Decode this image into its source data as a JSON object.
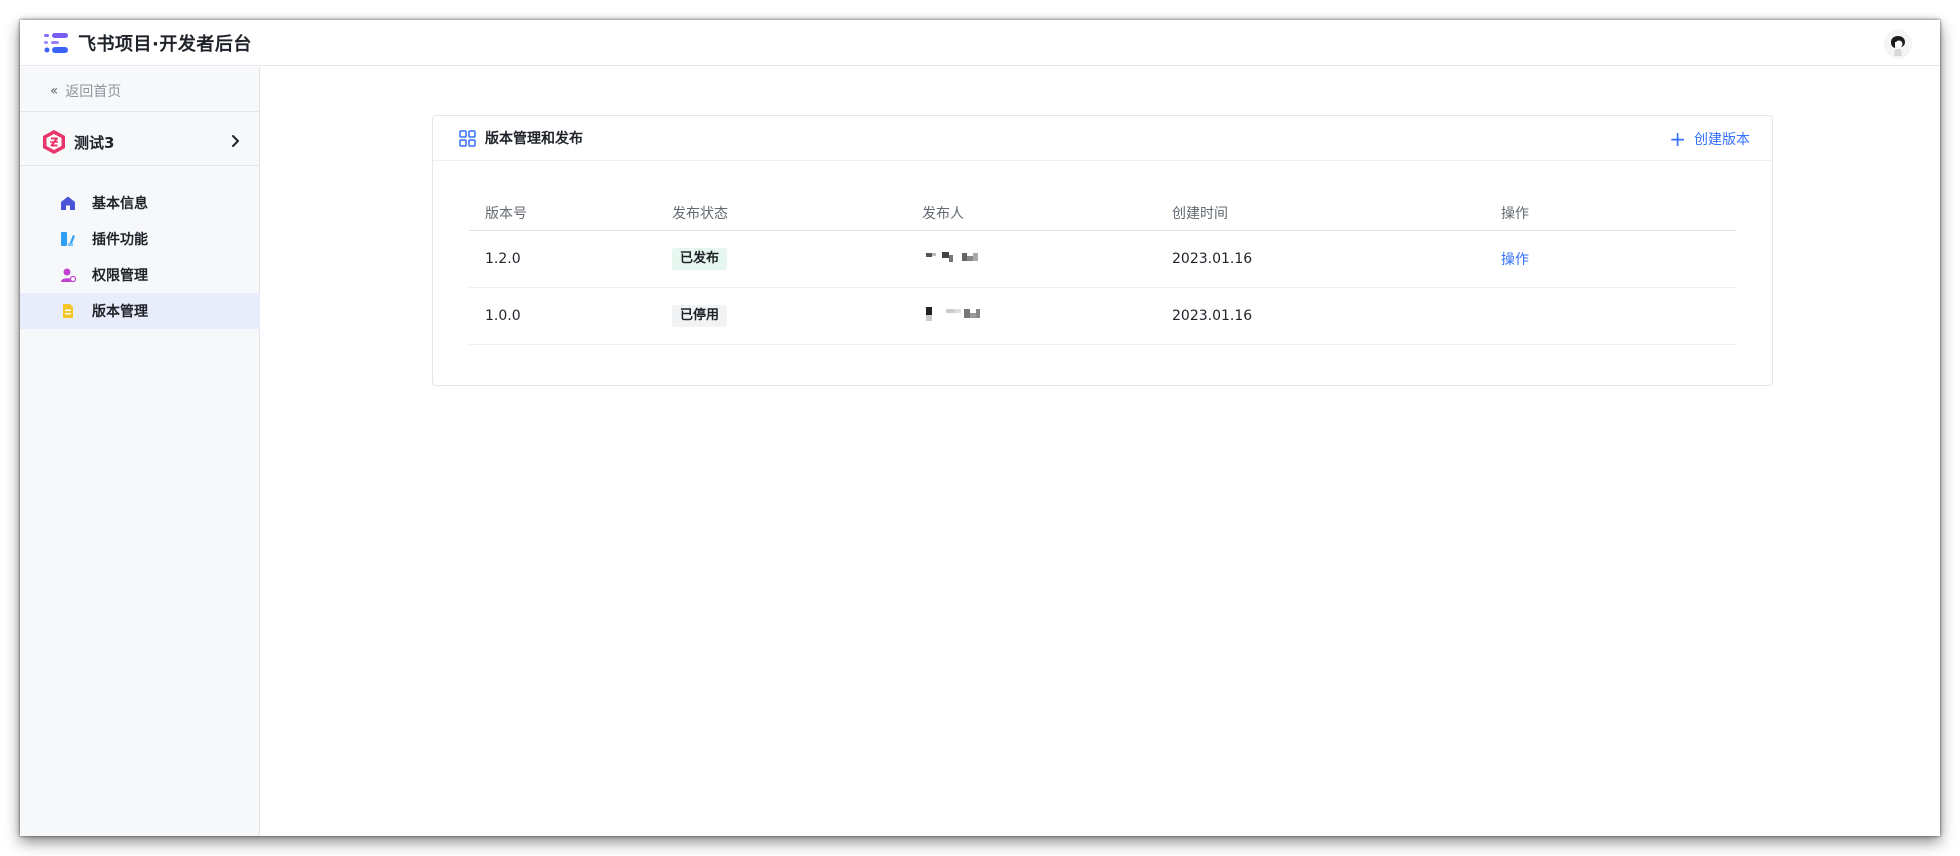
{
  "header": {
    "app_title": "飞书项目·开发者后台",
    "brand_color": "#7b5cf5"
  },
  "sidebar": {
    "back_label": "返回首页",
    "project": {
      "name": "测试3",
      "icon": "project-hexagon-icon"
    },
    "items": [
      {
        "label": "基本信息",
        "icon": "home-icon",
        "active": false
      },
      {
        "label": "插件功能",
        "icon": "plugin-icon",
        "active": false
      },
      {
        "label": "权限管理",
        "icon": "permission-user-icon",
        "active": false
      },
      {
        "label": "版本管理",
        "icon": "document-icon",
        "active": true
      }
    ]
  },
  "main": {
    "card_title": "版本管理和发布",
    "create_label": "创建版本",
    "table": {
      "columns": [
        "版本号",
        "发布状态",
        "发布人",
        "创建时间",
        "操作"
      ],
      "rows": [
        {
          "version": "1.2.0",
          "status": "已发布",
          "status_type": "published",
          "publisher": "",
          "created": "2023.01.16",
          "action": "操作"
        },
        {
          "version": "1.0.0",
          "status": "已停用",
          "status_type": "stopped",
          "publisher": "",
          "created": "2023.01.16",
          "action": ""
        }
      ]
    }
  },
  "colors": {
    "accent": "#3370ff",
    "active_bg": "#e8ecfb",
    "published_bg": "#e6f7ef"
  }
}
